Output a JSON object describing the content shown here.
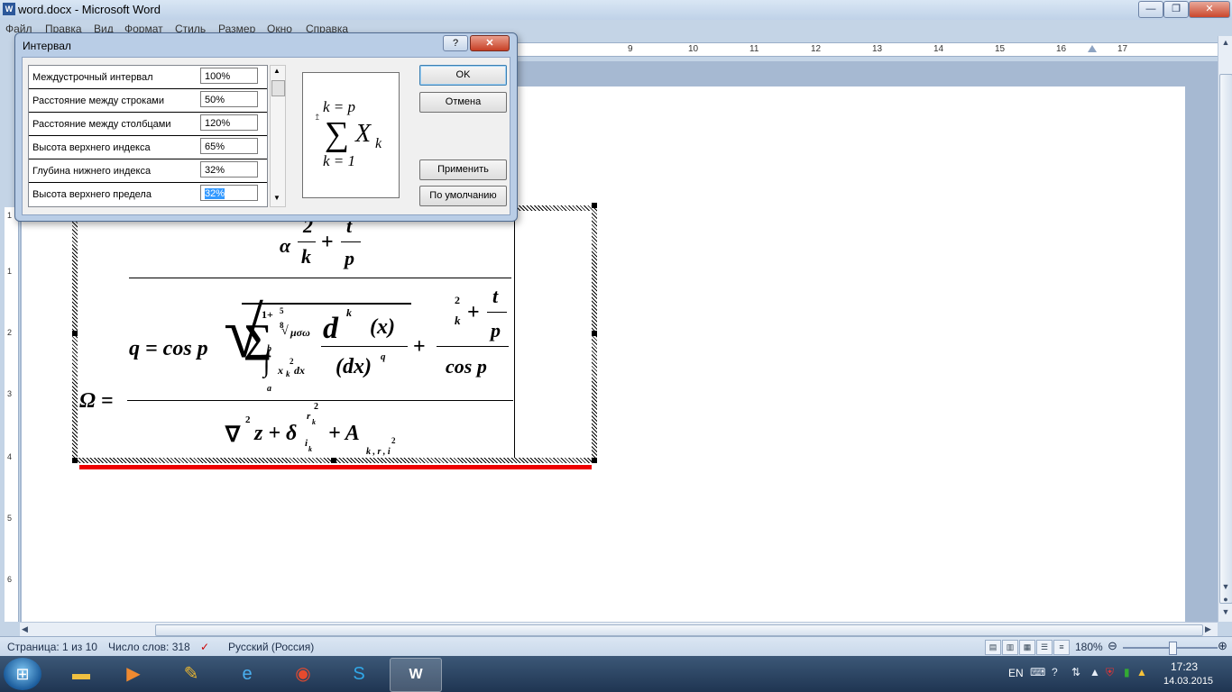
{
  "window": {
    "title": "word.docx - Microsoft Word",
    "minimize": "—",
    "maximize": "❐",
    "close": "✕"
  },
  "menu": [
    "Файл",
    "Правка",
    "Вид",
    "Формат",
    "Стиль",
    "Размер",
    "Окно",
    "Справка"
  ],
  "ruler": {
    "h_numbers": [
      "9",
      "10",
      "11",
      "12",
      "13",
      "14",
      "15",
      "16",
      "17"
    ],
    "v_numbers": [
      "1",
      "1",
      "2",
      "3",
      "4",
      "5",
      "6"
    ]
  },
  "dialog": {
    "title": "Интервал",
    "help": "?",
    "close": "✕",
    "params": [
      {
        "label": "Междустрочный интервал",
        "value": "100%"
      },
      {
        "label": "Расстояние между строками",
        "value": "50%"
      },
      {
        "label": "Расстояние между столбцами",
        "value": "120%"
      },
      {
        "label": "Высота верхнего индекса",
        "value": "65%"
      },
      {
        "label": "Глубина нижнего индекса",
        "value": "32%"
      },
      {
        "label": "Высота верхнего предела",
        "value": "32%"
      }
    ],
    "buttons": {
      "ok": "OK",
      "cancel": "Отмена",
      "apply": "Применить",
      "default": "По умолчанию"
    },
    "preview": {
      "upper": "k = p",
      "sigma": "∑",
      "body": "X",
      "body_sub": "k",
      "lower": "k = 1"
    }
  },
  "equation": {
    "omega": "Ω =",
    "top_num": "α",
    "top_frac1_num": "2",
    "top_frac1_den": "k",
    "top_plus": "+",
    "top_frac2_num": "t",
    "top_frac2_den": "p",
    "q_eq": "q = cos p",
    "radical": "√",
    "sum": "∑",
    "sum_upper": "1+",
    "root_index_num": "5",
    "root_index_den": "8",
    "root_body": "μσω",
    "integral": "∫",
    "int_upper": "b",
    "int_lower": "a",
    "int_body": "x",
    "int_sub": "k",
    "int_sup": "2",
    "int_dx": "dx",
    "deriv_num": "d",
    "deriv_num_sup": "k",
    "deriv_num_x": "(x)",
    "deriv_den": "(dx)",
    "deriv_den_sup": "q",
    "plus": "+",
    "right_k": "k",
    "right_sup": "2",
    "right_plus": "+",
    "right_t": "t",
    "right_p": "p",
    "right_den": "cos p",
    "den_nabla": "∇",
    "den_nabla_sup": "2",
    "den_z": "z + δ",
    "den_delta_sub": "i",
    "den_delta_subsub": "k",
    "den_delta_sup": "r",
    "den_delta_supsub": "k",
    "den_delta_supsup": "2",
    "den_plusA": "+ A",
    "den_A_sub": "k , r , i",
    "den_A_sub_sup": "2"
  },
  "status": {
    "page": "Страница: 1 из 10",
    "words": "Число слов: 318",
    "language": "Русский (Россия)",
    "zoom": "180%"
  },
  "taskbar": {
    "lang": "EN",
    "time": "17:23",
    "date": "14.03.2015",
    "word_label": "W"
  },
  "colors": {
    "accent_red": "#e00000",
    "selection": "#3399ff"
  }
}
